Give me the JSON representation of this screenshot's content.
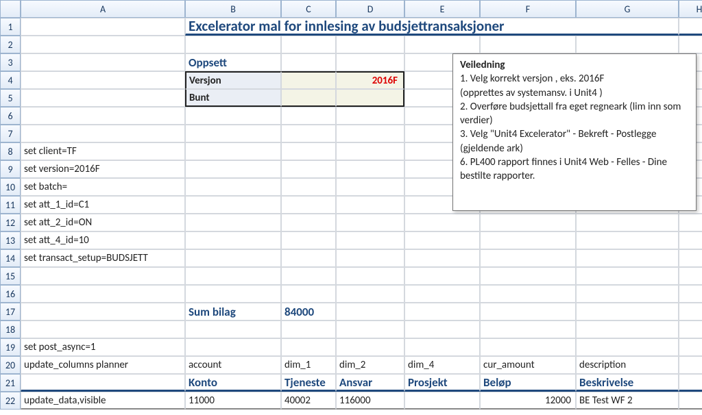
{
  "columns": [
    "A",
    "B",
    "C",
    "D",
    "E",
    "F",
    "G",
    "H"
  ],
  "row_numbers": [
    1,
    2,
    3,
    4,
    5,
    6,
    7,
    8,
    9,
    10,
    11,
    12,
    13,
    14,
    15,
    16,
    17,
    18,
    19,
    20,
    21,
    22
  ],
  "title": "Excelerator mal for innlesing av budsjettransaksjoner",
  "setup_header": "Oppsett",
  "version_label": "Versjon",
  "version_value": "2016F",
  "batch_label": "Bunt",
  "guide_title": "Veiledning",
  "guide_lines": [
    "1.   Velg korrekt versjon , eks. 2016F",
    " (opprettes av systemansv. i Unit4 )",
    "2.  Overføre budsjettall fra eget regneark (lim inn som verdier)",
    "3.  Velg \"Unit4 Excelerator\" - Bekreft - Postlegge  (gjeldende ark)",
    "6.  PL400 rapport finnes i Unit4 Web - Felles - Dine bestilte rapporter."
  ],
  "cmds": {
    "r8": "set client=TF",
    "r9": "set version=2016F",
    "r10": "set batch=",
    "r11": "set att_1_id=C1",
    "r12": "set att_2_id=ON",
    "r13": "set att_4_id=10",
    "r14": "set transact_setup=BUDSJETT",
    "r19": "set post_async=1",
    "r20": "update_columns planner",
    "r22": "update_data,visible"
  },
  "sum_label": "Sum bilag",
  "sum_value": "84000",
  "chart_data": {
    "type": "table",
    "tech_headers": [
      "account",
      "dim_1",
      "dim_2",
      "dim_4",
      "cur_amount",
      "description"
    ],
    "user_headers": [
      "Konto",
      "Tjeneste",
      "Ansvar",
      "Prosjekt",
      "Beløp",
      "Beskrivelse"
    ],
    "rows": [
      {
        "account": "11000",
        "dim_1": "40002",
        "dim_2": "116000",
        "dim_4": "",
        "cur_amount": "12000",
        "description": "BE Test WF 2"
      }
    ]
  }
}
